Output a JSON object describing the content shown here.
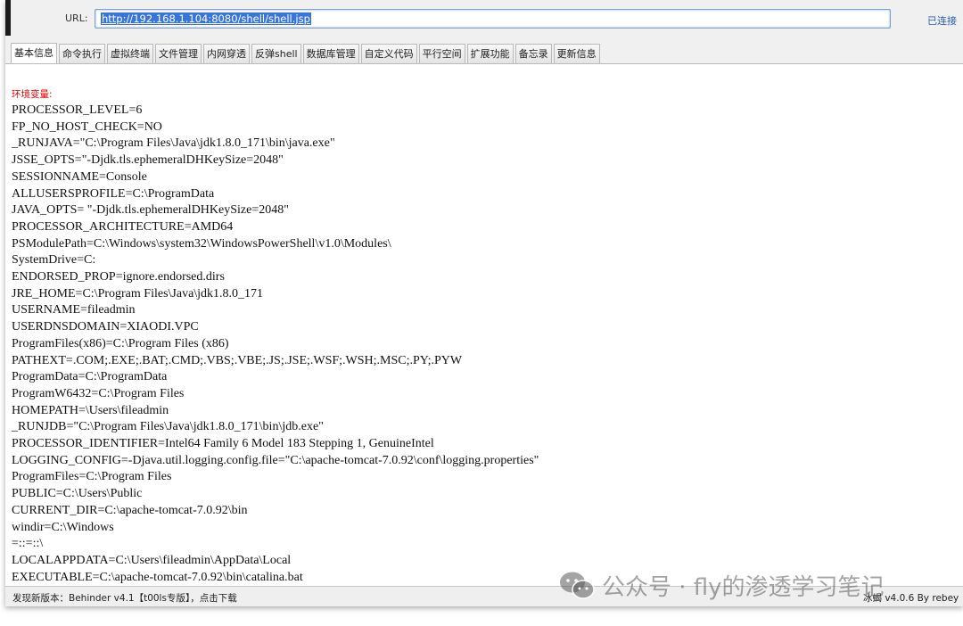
{
  "url_bar": {
    "label": "URL:",
    "value": "http://192.168.1.104:8080/shell/shell.jsp",
    "status": "已连接"
  },
  "tabs": [
    {
      "label": "基本信息",
      "active": true
    },
    {
      "label": "命令执行"
    },
    {
      "label": "虚拟终端"
    },
    {
      "label": "文件管理"
    },
    {
      "label": "内网穿透"
    },
    {
      "label": "反弹shell"
    },
    {
      "label": "数据库管理"
    },
    {
      "label": "自定义代码"
    },
    {
      "label": "平行空间"
    },
    {
      "label": "扩展功能"
    },
    {
      "label": "备忘录"
    },
    {
      "label": "更新信息"
    }
  ],
  "content": {
    "env_header": "环境变量:",
    "env_lines": [
      "PROCESSOR_LEVEL=6",
      "FP_NO_HOST_CHECK=NO",
      "_RUNJAVA=\"C:\\Program Files\\Java\\jdk1.8.0_171\\bin\\java.exe\"",
      "JSSE_OPTS=\"-Djdk.tls.ephemeralDHKeySize=2048\"",
      "SESSIONNAME=Console",
      "ALLUSERSPROFILE=C:\\ProgramData",
      "JAVA_OPTS= \"-Djdk.tls.ephemeralDHKeySize=2048\"",
      "PROCESSOR_ARCHITECTURE=AMD64",
      "PSModulePath=C:\\Windows\\system32\\WindowsPowerShell\\v1.0\\Modules\\",
      "SystemDrive=C:",
      "ENDORSED_PROP=ignore.endorsed.dirs",
      "JRE_HOME=C:\\Program Files\\Java\\jdk1.8.0_171",
      "USERNAME=fileadmin",
      "USERDNSDOMAIN=XIAODI.VPC",
      "ProgramFiles(x86)=C:\\Program Files (x86)",
      "PATHEXT=.COM;.EXE;.BAT;.CMD;.VBS;.VBE;.JS;.JSE;.WSF;.WSH;.MSC;.PY;.PYW",
      "ProgramData=C:\\ProgramData",
      "ProgramW6432=C:\\Program Files",
      "HOMEPATH=\\Users\\fileadmin",
      "_RUNJDB=\"C:\\Program Files\\Java\\jdk1.8.0_171\\bin\\jdb.exe\"",
      "PROCESSOR_IDENTIFIER=Intel64 Family 6 Model 183 Stepping 1, GenuineIntel",
      "LOGGING_CONFIG=-Djava.util.logging.config.file=\"C:\\apache-tomcat-7.0.92\\conf\\logging.properties\"",
      "ProgramFiles=C:\\Program Files",
      "PUBLIC=C:\\Users\\Public",
      "CURRENT_DIR=C:\\apache-tomcat-7.0.92\\bin",
      "windir=C:\\Windows",
      "=::=::\\",
      "LOCALAPPDATA=C:\\Users\\fileadmin\\AppData\\Local",
      "EXECUTABLE=C:\\apache-tomcat-7.0.92\\bin\\catalina.bat"
    ]
  },
  "statusbar": {
    "left": "发现新版本：Behinder v4.1【t00ls专版】，点击下载",
    "right": "冰蝎 v4.0.6   By rebey"
  },
  "watermark": {
    "text": "公众号 · fly的渗透学习笔记",
    "icon": "wechat-icon"
  },
  "colors": {
    "env_header": "#e00000",
    "url_selection": "#3875d7",
    "status_link": "#2a5db0"
  }
}
